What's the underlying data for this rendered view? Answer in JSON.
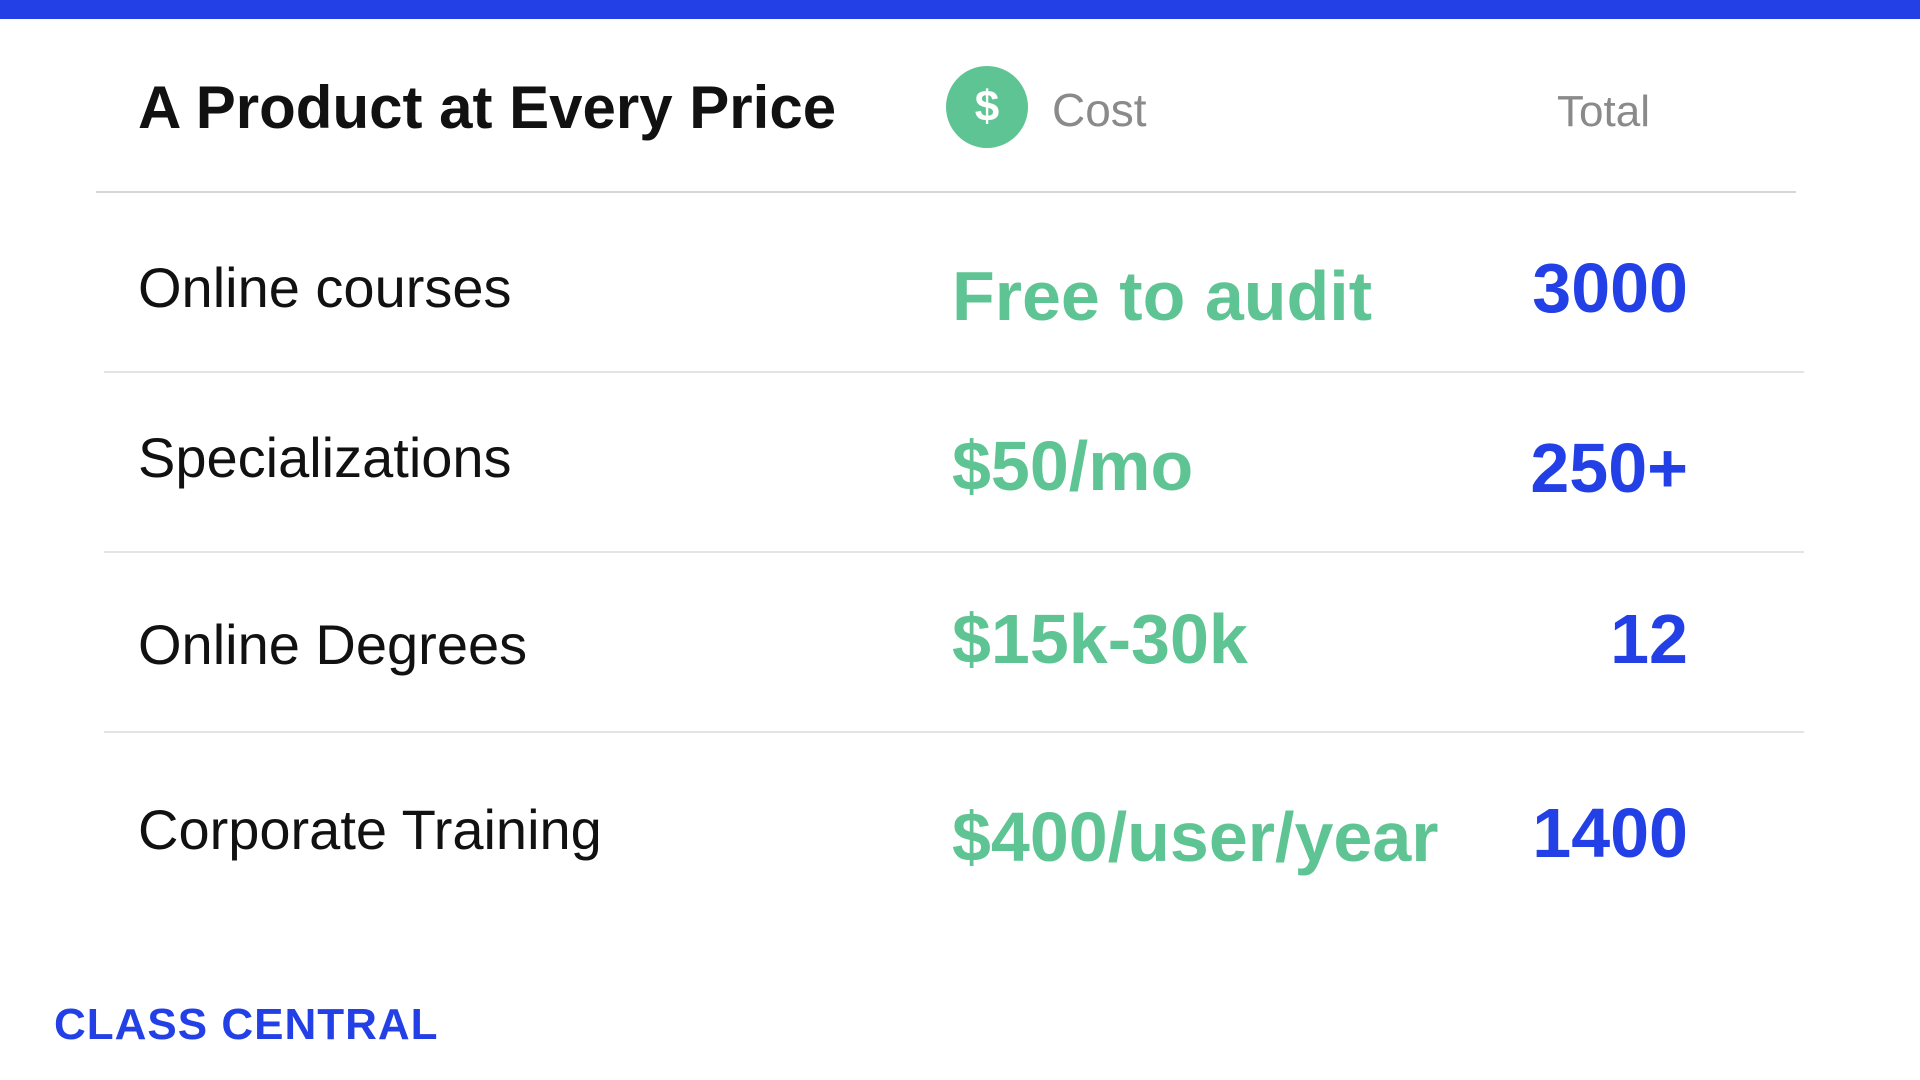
{
  "slide": {
    "title": "A Product at Every Price",
    "cost_icon": "dollar-icon",
    "cost_icon_glyph": "$",
    "cost_header": "Cost",
    "total_header": "Total",
    "accent_colors": {
      "top_bar": "#2340e6",
      "cost_green": "#5fc493",
      "total_blue": "#2340e6"
    },
    "rows": [
      {
        "label": "Online courses",
        "cost": "Free to audit",
        "total": "3000"
      },
      {
        "label": "Specializations",
        "cost": "$50/mo",
        "total": "250+"
      },
      {
        "label": "Online Degrees",
        "cost": "$15k-30k",
        "total": "12"
      },
      {
        "label": "Corporate Training",
        "cost": "$400/user/year",
        "total": "1400"
      }
    ],
    "logo_text": "CLASS CENTRAL"
  }
}
